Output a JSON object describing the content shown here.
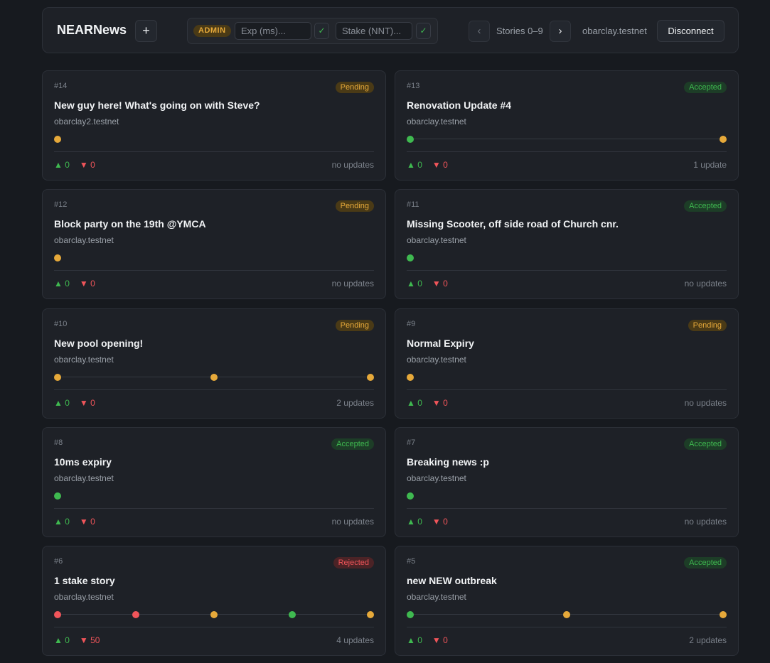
{
  "header": {
    "brand": "NEARNews",
    "add_label": "+",
    "admin_badge": "ADMIN",
    "exp_placeholder": "Exp (ms)...",
    "stake_placeholder": "Stake (NNT)...",
    "check_label": "✓",
    "prev_label": "‹",
    "next_label": "›",
    "range": "Stories 0–9",
    "account": "obarclay.testnet",
    "disconnect_label": "Disconnect"
  },
  "colors": {
    "pending": "#e6a93a",
    "accepted": "#3fb950",
    "rejected": "#f0555a",
    "background": "#171a1f",
    "card": "#1e2127"
  },
  "stories": [
    {
      "id": "#14",
      "status": "Pending",
      "title": "New guy here! What's going on with Steve?",
      "author": "obarclay2.testnet",
      "timeline": [
        "pending"
      ],
      "up": "▲ 0",
      "down": "▼ 0",
      "updates": "no updates"
    },
    {
      "id": "#13",
      "status": "Accepted",
      "title": "Renovation Update #4",
      "author": "obarclay.testnet",
      "timeline": [
        "accepted",
        "pending"
      ],
      "up": "▲ 0",
      "down": "▼ 0",
      "updates": "1 update"
    },
    {
      "id": "#12",
      "status": "Pending",
      "title": "Block party on the 19th @YMCA",
      "author": "obarclay.testnet",
      "timeline": [
        "pending"
      ],
      "up": "▲ 0",
      "down": "▼ 0",
      "updates": "no updates"
    },
    {
      "id": "#11",
      "status": "Accepted",
      "title": "Missing Scooter, off side road of Church cnr.",
      "author": "obarclay.testnet",
      "timeline": [
        "accepted"
      ],
      "up": "▲ 0",
      "down": "▼ 0",
      "updates": "no updates"
    },
    {
      "id": "#10",
      "status": "Pending",
      "title": "New pool opening!",
      "author": "obarclay.testnet",
      "timeline": [
        "pending",
        "pending",
        "pending"
      ],
      "up": "▲ 0",
      "down": "▼ 0",
      "updates": "2 updates"
    },
    {
      "id": "#9",
      "status": "Pending",
      "title": "Normal Expiry",
      "author": "obarclay.testnet",
      "timeline": [
        "pending"
      ],
      "up": "▲ 0",
      "down": "▼ 0",
      "updates": "no updates"
    },
    {
      "id": "#8",
      "status": "Accepted",
      "title": "10ms expiry",
      "author": "obarclay.testnet",
      "timeline": [
        "accepted"
      ],
      "up": "▲ 0",
      "down": "▼ 0",
      "updates": "no updates"
    },
    {
      "id": "#7",
      "status": "Accepted",
      "title": "Breaking news :p",
      "author": "obarclay.testnet",
      "timeline": [
        "accepted"
      ],
      "up": "▲ 0",
      "down": "▼ 0",
      "updates": "no updates"
    },
    {
      "id": "#6",
      "status": "Rejected",
      "title": "1 stake story",
      "author": "obarclay.testnet",
      "timeline": [
        "rejected",
        "rejected",
        "pending",
        "accepted",
        "pending"
      ],
      "up": "▲ 0",
      "down": "▼ 50",
      "updates": "4 updates"
    },
    {
      "id": "#5",
      "status": "Accepted",
      "title": "new NEW outbreak",
      "author": "obarclay.testnet",
      "timeline": [
        "accepted",
        "pending",
        "pending"
      ],
      "up": "▲ 0",
      "down": "▼ 0",
      "updates": "2 updates"
    }
  ]
}
